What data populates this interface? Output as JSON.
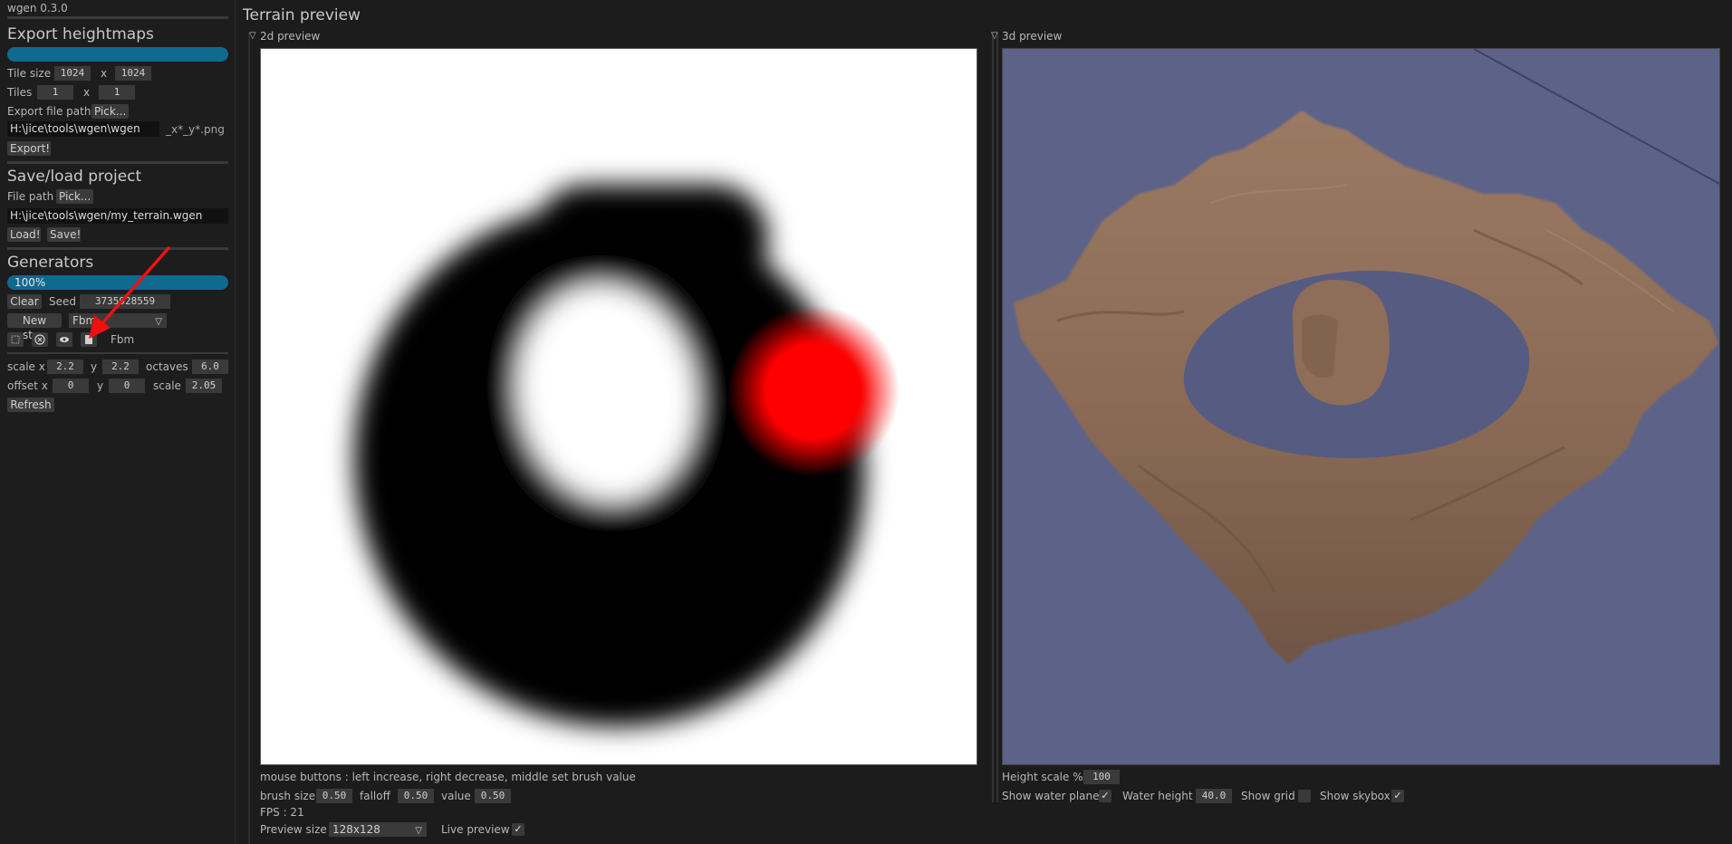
{
  "app": {
    "version": "wgen 0.3.0"
  },
  "export": {
    "title": "Export heightmaps",
    "tile_size_label": "Tile size",
    "tile_size_x": "1024",
    "x_sep": "x",
    "tile_size_y": "1024",
    "tiles_label": "Tiles",
    "tiles_x": "1",
    "tiles_y": "1",
    "file_path_label": "Export file path",
    "pick_label": "Pick...",
    "path_value": "H:\\jice\\tools\\wgen\\wgen",
    "suffix": "_x*_y*.png",
    "export_button": "Export!"
  },
  "project": {
    "title": "Save/load project",
    "file_path_label": "File path",
    "pick_label": "Pick...",
    "path_value": "H:\\jice\\tools\\wgen/my_terrain.wgen",
    "load_button": "Load!",
    "save_button": "Save!"
  },
  "generators": {
    "title": "Generators",
    "progress": "100%",
    "clear_button": "Clear",
    "seed_label": "Seed",
    "seed_value": "3735928559",
    "new_step_button": "New step",
    "step_type": "Fbm",
    "step_name": "Fbm",
    "icons": [
      "step-toggle-icon",
      "delete-step-icon",
      "visibility-icon",
      "step-options-icon"
    ]
  },
  "fbm": {
    "scale_x_label": "scale x",
    "scale_x": "2.2",
    "y_label": "y",
    "scale_y": "2.2",
    "octaves_label": "octaves",
    "octaves": "6.0",
    "offset_x_label": "offset x",
    "offset_x": "0",
    "offset_y": "0",
    "scale_label": "scale",
    "scale": "2.05",
    "refresh_button": "Refresh"
  },
  "main": {
    "title": "Terrain preview",
    "preview_2d_header": "2d preview",
    "preview_3d_header": "3d preview",
    "mouse_help": "mouse buttons : left increase, right decrease, middle set brush value",
    "brush_size_label": "brush size",
    "brush_size": "0.50",
    "falloff_label": "falloff",
    "falloff": "0.50",
    "value_label": "value",
    "value": "0.50",
    "fps": "FPS : 21",
    "preview_size_label": "Preview size",
    "preview_size": "128x128",
    "live_preview_label": "Live preview",
    "live_preview_checked": true,
    "height_scale_label": "Height scale %",
    "height_scale": "100",
    "show_water_label": "Show water plane",
    "show_water_checked": true,
    "water_height_label": "Water height",
    "water_height": "40.0",
    "show_grid_label": "Show grid",
    "show_grid_checked": false,
    "show_skybox_label": "Show skybox",
    "show_skybox_checked": true
  },
  "colors": {
    "accent_bar": "#106a8f",
    "brush": "#ff0000",
    "water": "#5d6288",
    "terrain": "#8a6a55"
  }
}
